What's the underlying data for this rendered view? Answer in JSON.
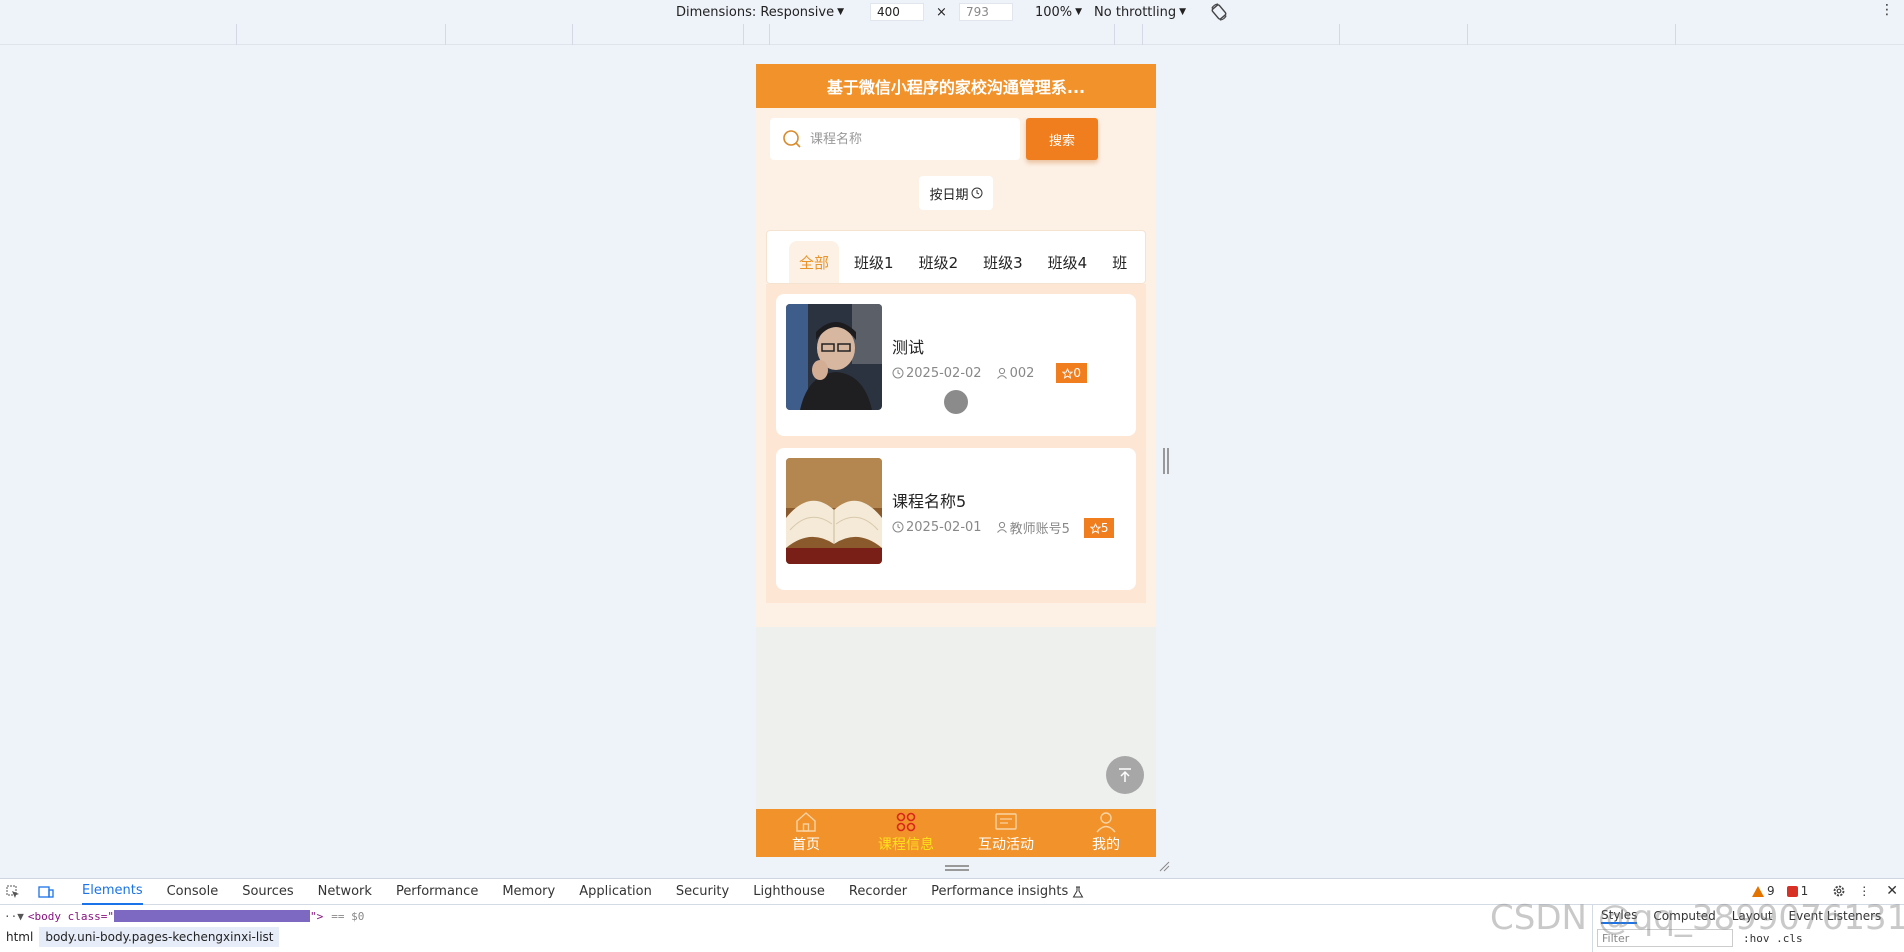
{
  "devtools_toolbar": {
    "dimensions_label": "Dimensions: Responsive",
    "width": "400",
    "height": "793",
    "zoom": "100%",
    "throttling": "No throttling"
  },
  "app": {
    "title": "基于微信小程序的家校沟通管理系...",
    "search": {
      "placeholder": "课程名称",
      "button": "搜索"
    },
    "date_sort": "按日期",
    "tabs": [
      "全部",
      "班级1",
      "班级2",
      "班级3",
      "班级4",
      "班"
    ],
    "courses": [
      {
        "title": "测试",
        "date": "2025-02-02",
        "teacher": "002",
        "favorites": "0"
      },
      {
        "title": "课程名称5",
        "date": "2025-02-01",
        "teacher": "教师账号5",
        "favorites": "5"
      }
    ],
    "tabbar": [
      {
        "label": "首页",
        "icon": "home-icon"
      },
      {
        "label": "课程信息",
        "icon": "command-icon"
      },
      {
        "label": "互动活动",
        "icon": "message-icon"
      },
      {
        "label": "我的",
        "icon": "user-icon"
      }
    ]
  },
  "devtools": {
    "tabs": [
      "Elements",
      "Console",
      "Sources",
      "Network",
      "Performance",
      "Memory",
      "Application",
      "Security",
      "Lighthouse",
      "Recorder",
      "Performance insights"
    ],
    "warnings": "9",
    "errors": "1",
    "dom_tag_open": "<body class=\"",
    "dom_tag_close": "\">",
    "dom_eq": "== $0",
    "breadcrumbs": [
      "html",
      "body.uni-body.pages-kechengxinxi-list"
    ],
    "styles_tabs": [
      "Styles",
      "Computed",
      "Layout",
      "Event Listeners"
    ],
    "filter_placeholder": "Filter",
    "style_tools": ":hov .cls"
  },
  "watermark": "CSDN @qq_3899076131",
  "colors": {
    "primary": "#f1922b",
    "button": "#f07e1f",
    "active_tab_text": "#e8942a",
    "tabbar_active": "#ffe21a"
  }
}
